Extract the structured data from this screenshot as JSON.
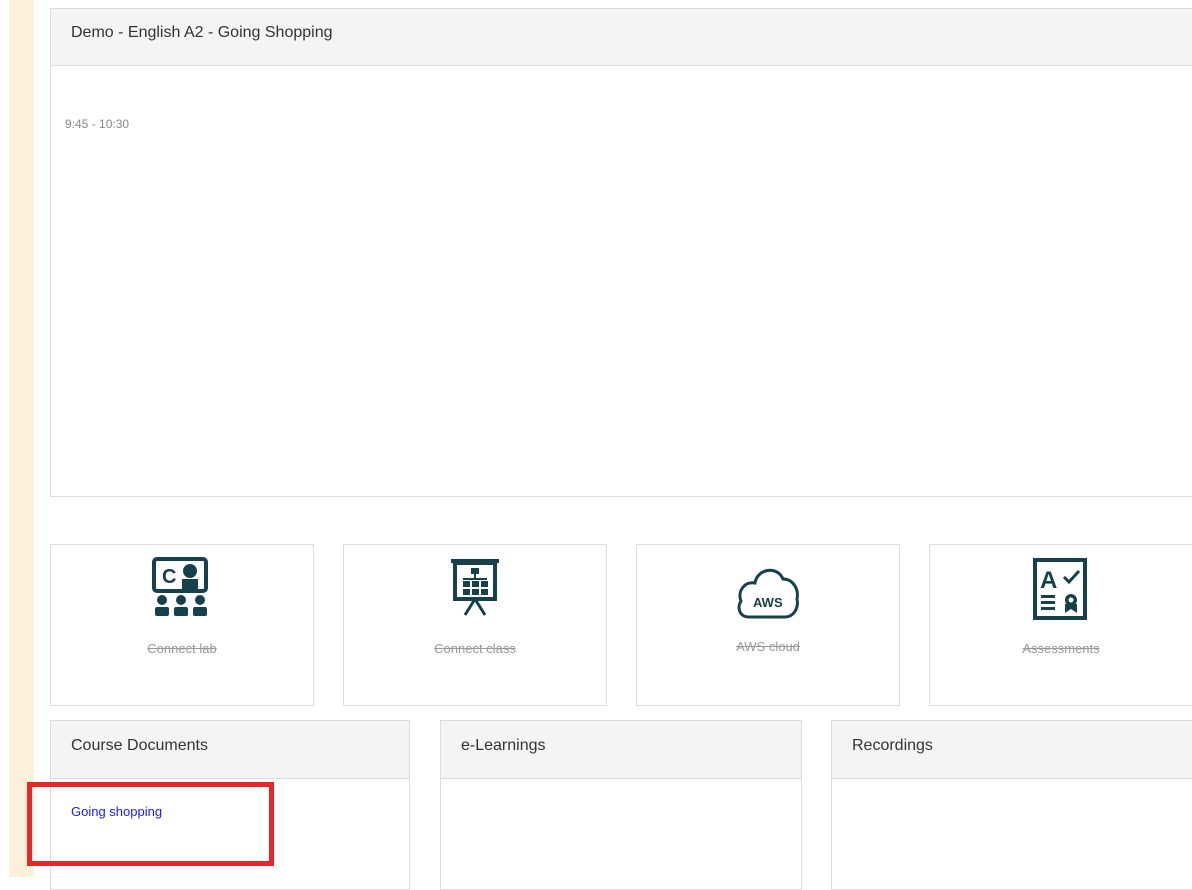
{
  "course": {
    "title": "Demo - English A2 - Going Shopping",
    "time": "9:45 - 10:30"
  },
  "tools": [
    {
      "label": "Connect lab",
      "icon": "connect-lab-icon"
    },
    {
      "label": "Connect class",
      "icon": "presentation-board-icon"
    },
    {
      "label": "AWS cloud",
      "icon": "aws-cloud-icon",
      "icon_text": "AWS"
    },
    {
      "label": "Assessments",
      "icon": "assessment-certificate-icon",
      "icon_text": "A"
    }
  ],
  "panels": {
    "course_documents": {
      "title": "Course Documents",
      "items": [
        {
          "label": "Going shopping"
        }
      ]
    },
    "elearnings": {
      "title": "e-Learnings"
    },
    "recordings": {
      "title": "Recordings"
    }
  },
  "colors": {
    "icon": "#17404d",
    "link": "#1a1aff",
    "highlight": "#e8262a",
    "side_strip": "#fdf0da"
  }
}
